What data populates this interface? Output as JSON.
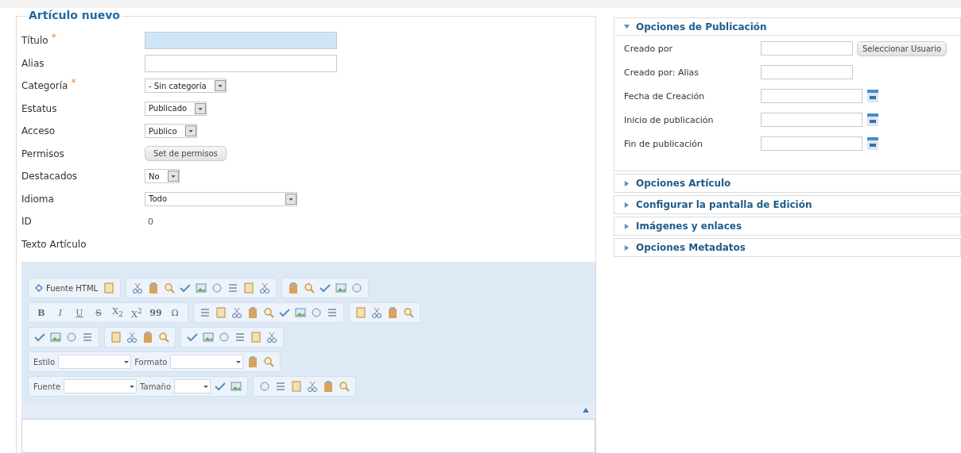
{
  "article": {
    "legend": "Artículo nuevo",
    "fields": [
      {
        "label": "Título",
        "mark": "*",
        "kind": "text",
        "focused": true
      },
      {
        "label": "Alias",
        "kind": "text",
        "focused": false
      },
      {
        "label": "Categoría",
        "mark": "*",
        "kind": "select",
        "value": "- Sin categoría"
      },
      {
        "label": "Estatus",
        "kind": "select",
        "value": "Publicado"
      },
      {
        "label": "Acceso",
        "kind": "select",
        "value": "Publico"
      },
      {
        "label": "Permisos",
        "kind": "button",
        "value": "Set de permisos"
      },
      {
        "label": "Destacados",
        "kind": "select",
        "value": "No"
      },
      {
        "label": "Idioma",
        "kind": "list",
        "value": "Todo"
      },
      {
        "label": "ID",
        "kind": "static",
        "value": "0"
      },
      {
        "label": "Texto Artículo",
        "kind": "none"
      }
    ],
    "editor": {
      "rows": [
        [
          [
            {
              "kind": "button",
              "text": "Fuente HTML"
            },
            {
              "kind": "icon"
            }
          ],
          [
            {
              "kind": "icon"
            },
            {
              "kind": "icon"
            },
            {
              "kind": "icon"
            },
            {
              "kind": "icon"
            },
            {
              "kind": "icon"
            },
            {
              "kind": "icon"
            },
            {
              "kind": "icon"
            },
            {
              "kind": "icon"
            },
            {
              "kind": "icon"
            }
          ],
          [
            {
              "kind": "icon"
            },
            {
              "kind": "icon"
            },
            {
              "kind": "icon"
            },
            {
              "kind": "icon"
            },
            {
              "kind": "icon"
            }
          ]
        ],
        [
          [
            {
              "kind": "glyph",
              "text": "B"
            },
            {
              "kind": "glyph",
              "text": "I"
            },
            {
              "kind": "glyph",
              "text": "U"
            },
            {
              "kind": "glyph",
              "text": "S"
            },
            {
              "kind": "glyph",
              "text": "X$_{2}$"
            },
            {
              "kind": "glyph",
              "text": "X$^{2}$"
            },
            {
              "kind": "glyph",
              "text": "99"
            },
            {
              "kind": "glyph",
              "text": "Ω"
            }
          ],
          [
            {
              "kind": "icon"
            },
            {
              "kind": "icon"
            },
            {
              "kind": "icon"
            },
            {
              "kind": "icon"
            },
            {
              "kind": "icon"
            },
            {
              "kind": "icon"
            },
            {
              "kind": "icon"
            },
            {
              "kind": "icon"
            },
            {
              "kind": "icon"
            }
          ],
          [
            {
              "kind": "icon"
            },
            {
              "kind": "icon"
            },
            {
              "kind": "icon"
            },
            {
              "kind": "icon"
            }
          ]
        ],
        [
          [
            {
              "kind": "icon"
            },
            {
              "kind": "icon"
            },
            {
              "kind": "icon"
            },
            {
              "kind": "icon"
            }
          ],
          [
            {
              "kind": "icon"
            },
            {
              "kind": "icon"
            },
            {
              "kind": "icon"
            },
            {
              "kind": "icon"
            }
          ],
          [
            {
              "kind": "icon"
            },
            {
              "kind": "icon"
            },
            {
              "kind": "icon"
            },
            {
              "kind": "icon"
            },
            {
              "kind": "icon"
            },
            {
              "kind": "icon"
            }
          ]
        ],
        [
          [
            {
              "kind": "combo",
              "text": "Estilo"
            },
            {
              "kind": "combo",
              "text": "Formato"
            },
            {
              "kind": "icon"
            },
            {
              "kind": "icon"
            }
          ]
        ],
        [
          [
            {
              "kind": "combo",
              "text": "Fuente"
            },
            {
              "kind": "combo",
              "text": "Tamaño"
            },
            {
              "kind": "icon"
            },
            {
              "kind": "icon"
            }
          ],
          [
            {
              "kind": "icon"
            },
            {
              "kind": "icon"
            },
            {
              "kind": "icon"
            },
            {
              "kind": "icon"
            },
            {
              "kind": "icon"
            },
            {
              "kind": "icon"
            }
          ]
        ]
      ]
    }
  },
  "options": {
    "panels": [
      {
        "title": "Opciones de Publicación",
        "expanded": true,
        "fields": [
          {
            "label": "Creado por",
            "kind": "user",
            "button": "Seleccionar Usuario"
          },
          {
            "label": "Creado por: Alias",
            "kind": "text"
          },
          {
            "label": "Fecha de Creación",
            "kind": "date"
          },
          {
            "label": "Inicio de publicación",
            "kind": "date"
          },
          {
            "label": "Fin de publicación",
            "kind": "date"
          }
        ]
      },
      {
        "title": "Opciones Artículo",
        "expanded": false
      },
      {
        "title": "Configurar la pantalla de Edición",
        "expanded": false
      },
      {
        "title": "Imágenes y enlaces",
        "expanded": false
      },
      {
        "title": "Opciones Metadatos",
        "expanded": false
      }
    ]
  }
}
